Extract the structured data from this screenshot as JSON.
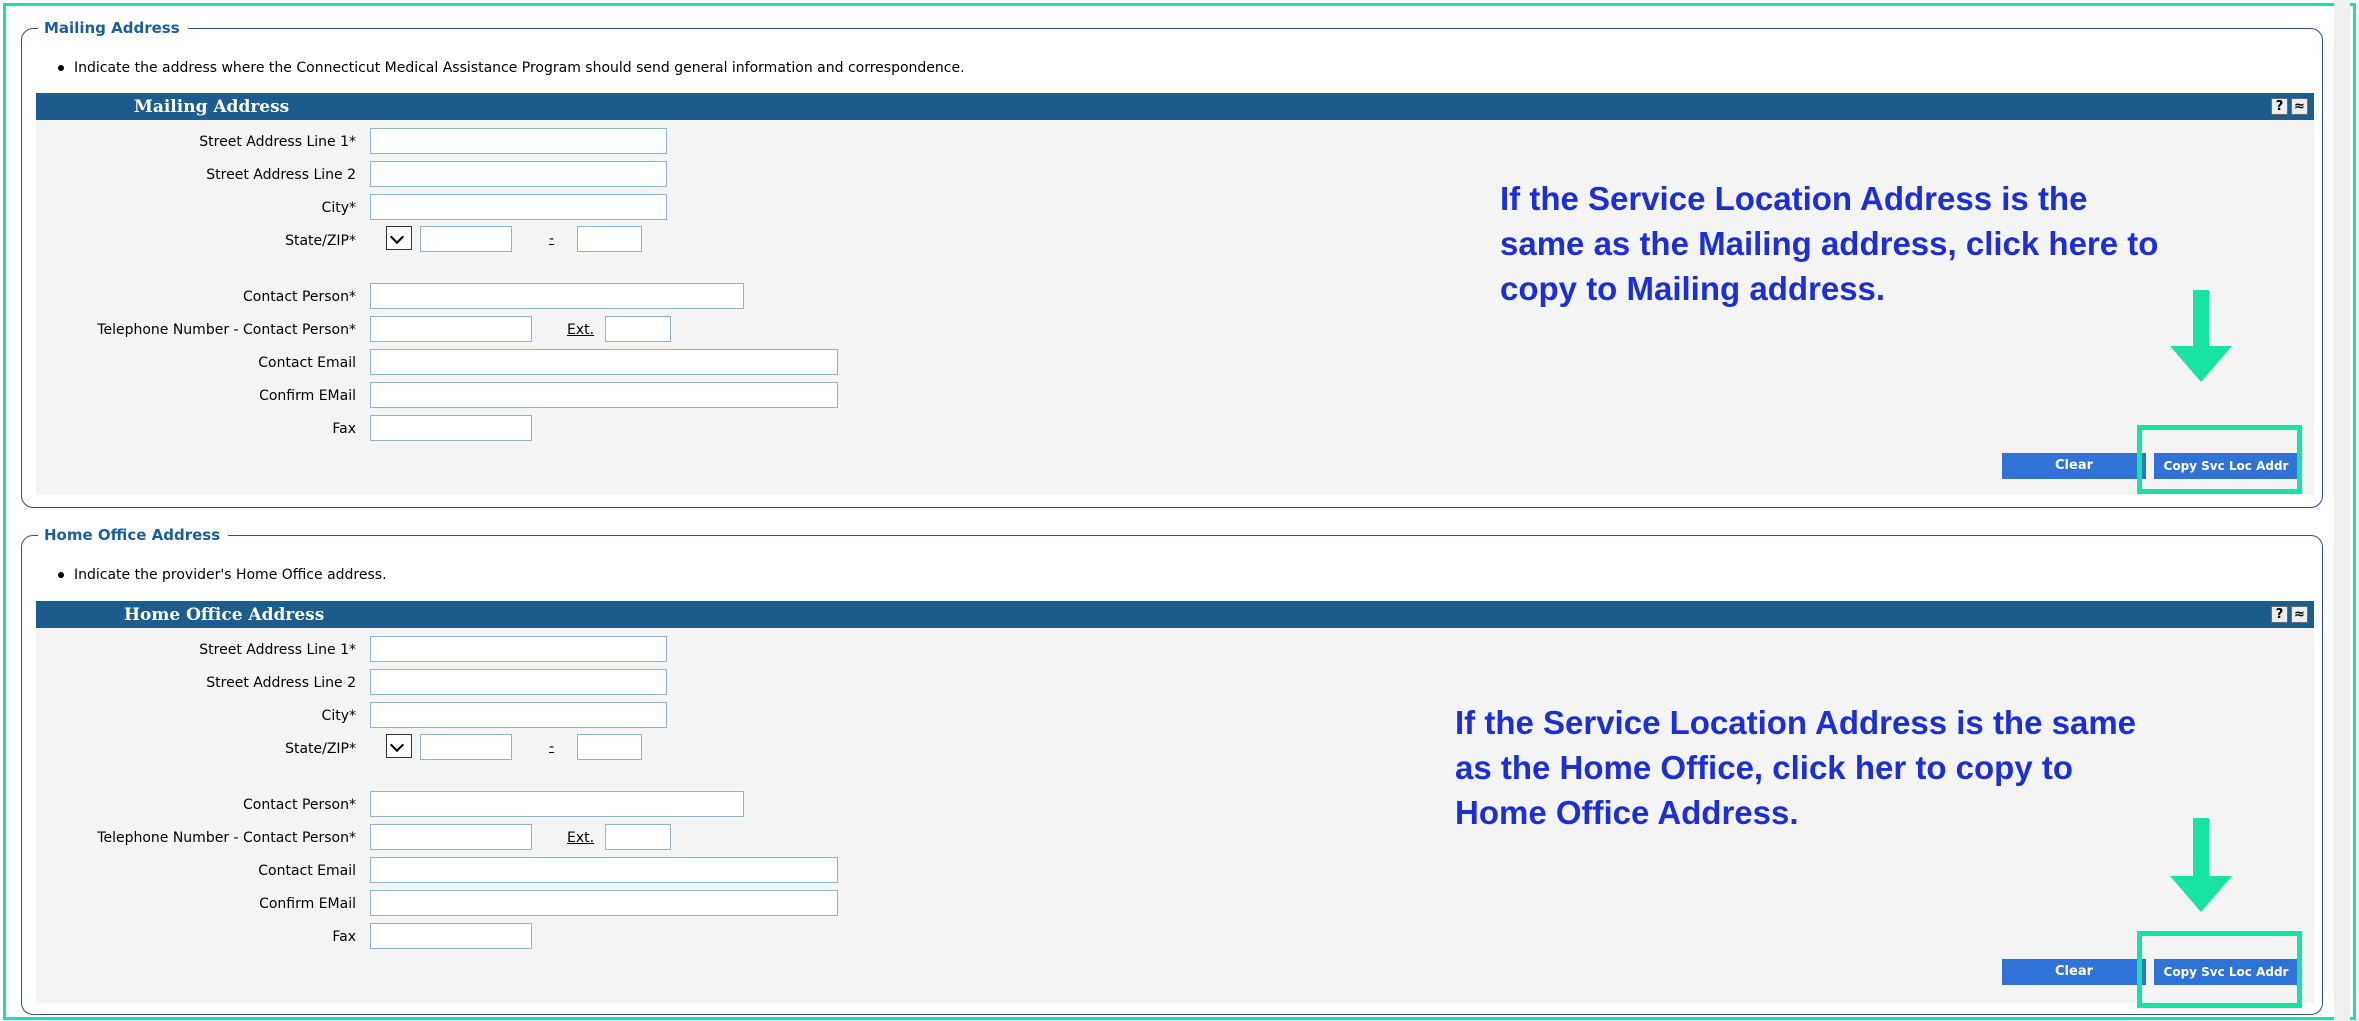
{
  "sections": [
    {
      "legend": "Mailing Address",
      "instruction": "Indicate the address where the Connecticut Medical Assistance Program should send general information and correspondence.",
      "panel_title": "Mailing Address",
      "help_glyph": "?",
      "collapse_glyph": "≈",
      "labels": {
        "street1": "Street Address Line 1*",
        "street2": "Street Address Line 2",
        "city": "City*",
        "state_zip": "State/ZIP*",
        "contact": "Contact Person*",
        "phone": "Telephone Number - Contact Person*",
        "email": "Contact Email",
        "confirm": "Confirm EMail",
        "fax": "Fax"
      },
      "zip_dash": "-",
      "ext_label": "Ext.",
      "clear_label": "Clear",
      "copy_label": "Copy Svc Loc Addr",
      "annotation": [
        "If the Service Location Address is the",
        "same as the Mailing address, click here to",
        "copy to Mailing address."
      ]
    },
    {
      "legend": "Home Office Address",
      "instruction": "Indicate the provider's Home Office address.",
      "panel_title": "Home Office Address",
      "help_glyph": "?",
      "collapse_glyph": "≈",
      "labels": {
        "street1": "Street Address Line 1*",
        "street2": "Street Address Line 2",
        "city": "City*",
        "state_zip": "State/ZIP*",
        "contact": "Contact Person*",
        "phone": "Telephone Number - Contact Person*",
        "email": "Contact Email",
        "confirm": "Confirm EMail",
        "fax": "Fax"
      },
      "zip_dash": "-",
      "ext_label": "Ext.",
      "clear_label": "Clear",
      "copy_label": "Copy Svc Loc Addr",
      "annotation": [
        "If the Service Location Address is the same",
        "as the Home Office, click her to copy to",
        "Home Office Address."
      ]
    }
  ],
  "colors": {
    "highlight": "#18e3a3",
    "header": "#1c5d8e",
    "annotation": "#1c2fd6",
    "button": "#2f73d9"
  }
}
